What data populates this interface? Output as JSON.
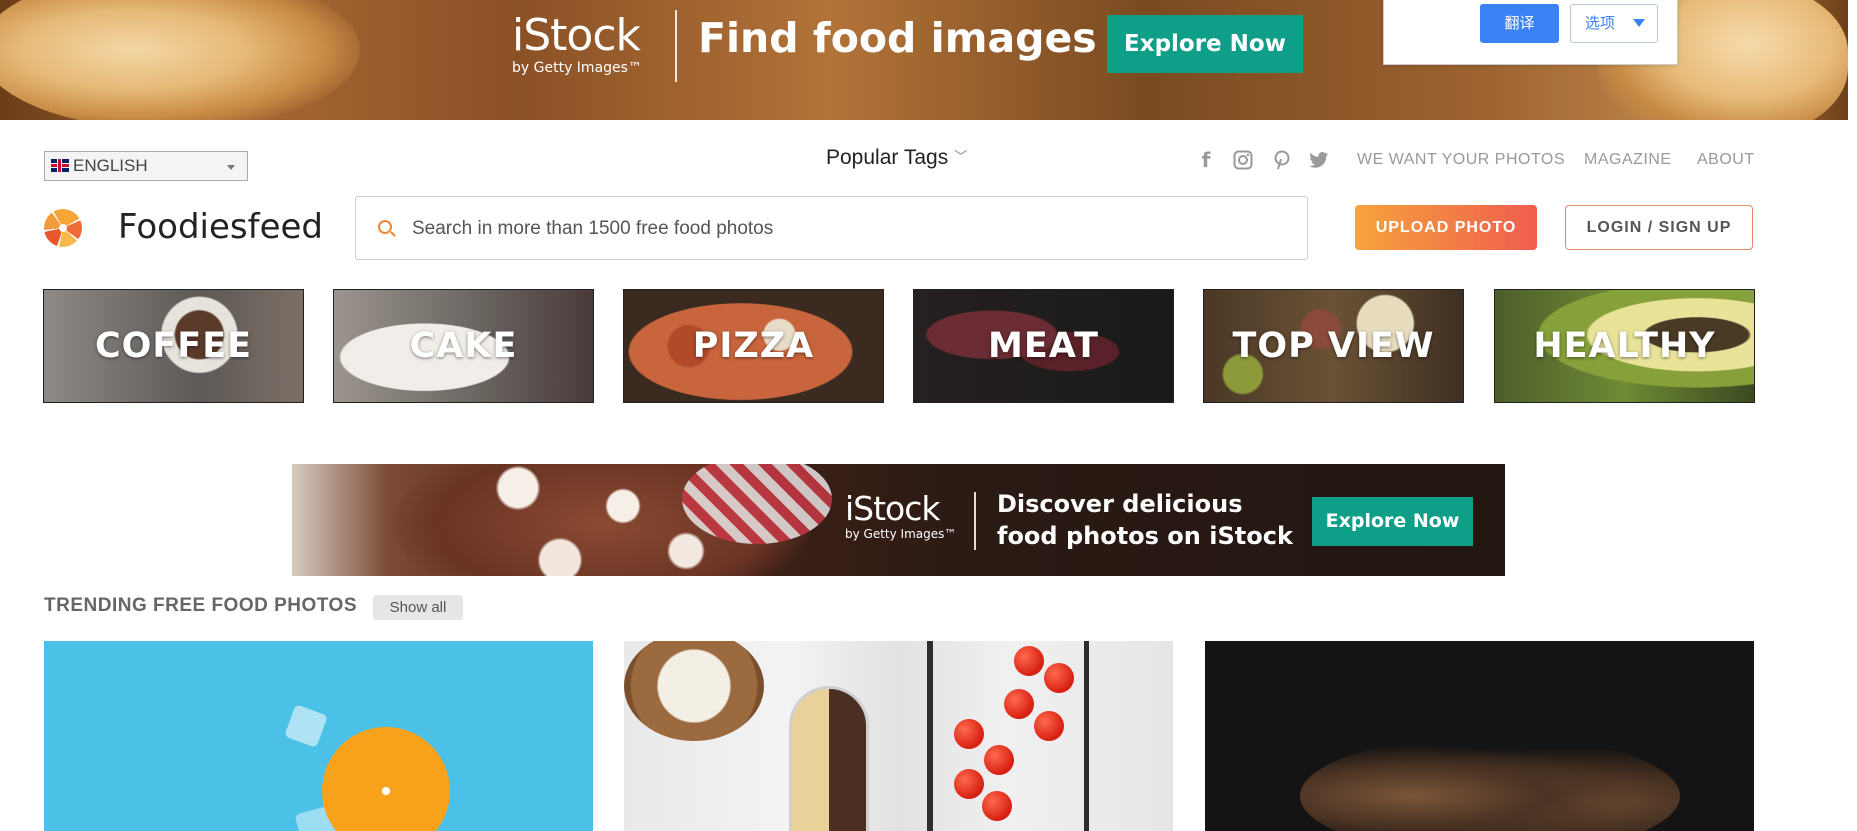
{
  "top_ad": {
    "brand": "iStock",
    "brand_sub": "by Getty Images™",
    "headline": "Find food images",
    "cta": "Explore Now"
  },
  "translate_popup": {
    "translate_label": "翻译",
    "options_label": "选项"
  },
  "nav": {
    "language": "ENGLISH",
    "popular_tags": "Popular Tags",
    "social_icons": [
      "facebook-icon",
      "instagram-icon",
      "pinterest-icon",
      "twitter-icon"
    ],
    "links": [
      "WE WANT YOUR PHOTOS",
      "MAGAZINE",
      "ABOUT"
    ]
  },
  "header": {
    "logo_text": "Foodiesfeed",
    "search_placeholder": "Search in more than 1500 free food photos",
    "upload_label": "UPLOAD PHOTO",
    "login_label": "LOGIN / SIGN UP"
  },
  "categories": [
    {
      "label": "COFFEE",
      "color": "#6d6b66"
    },
    {
      "label": "CAKE",
      "color": "#7d7670"
    },
    {
      "label": "PIZZA",
      "color": "#8a5a45"
    },
    {
      "label": "MEAT",
      "color": "#3b2526"
    },
    {
      "label": "TOP VIEW",
      "color": "#5a4733"
    },
    {
      "label": "HEALTHY",
      "color": "#6f7d3a"
    }
  ],
  "mid_ad": {
    "brand": "iStock",
    "brand_sub": "by Getty Images™",
    "line1": "Discover delicious",
    "line2": "food photos on iStock",
    "cta": "Explore Now"
  },
  "trending": {
    "title": "TRENDING FREE FOOD PHOTOS",
    "show_all": "Show all"
  }
}
